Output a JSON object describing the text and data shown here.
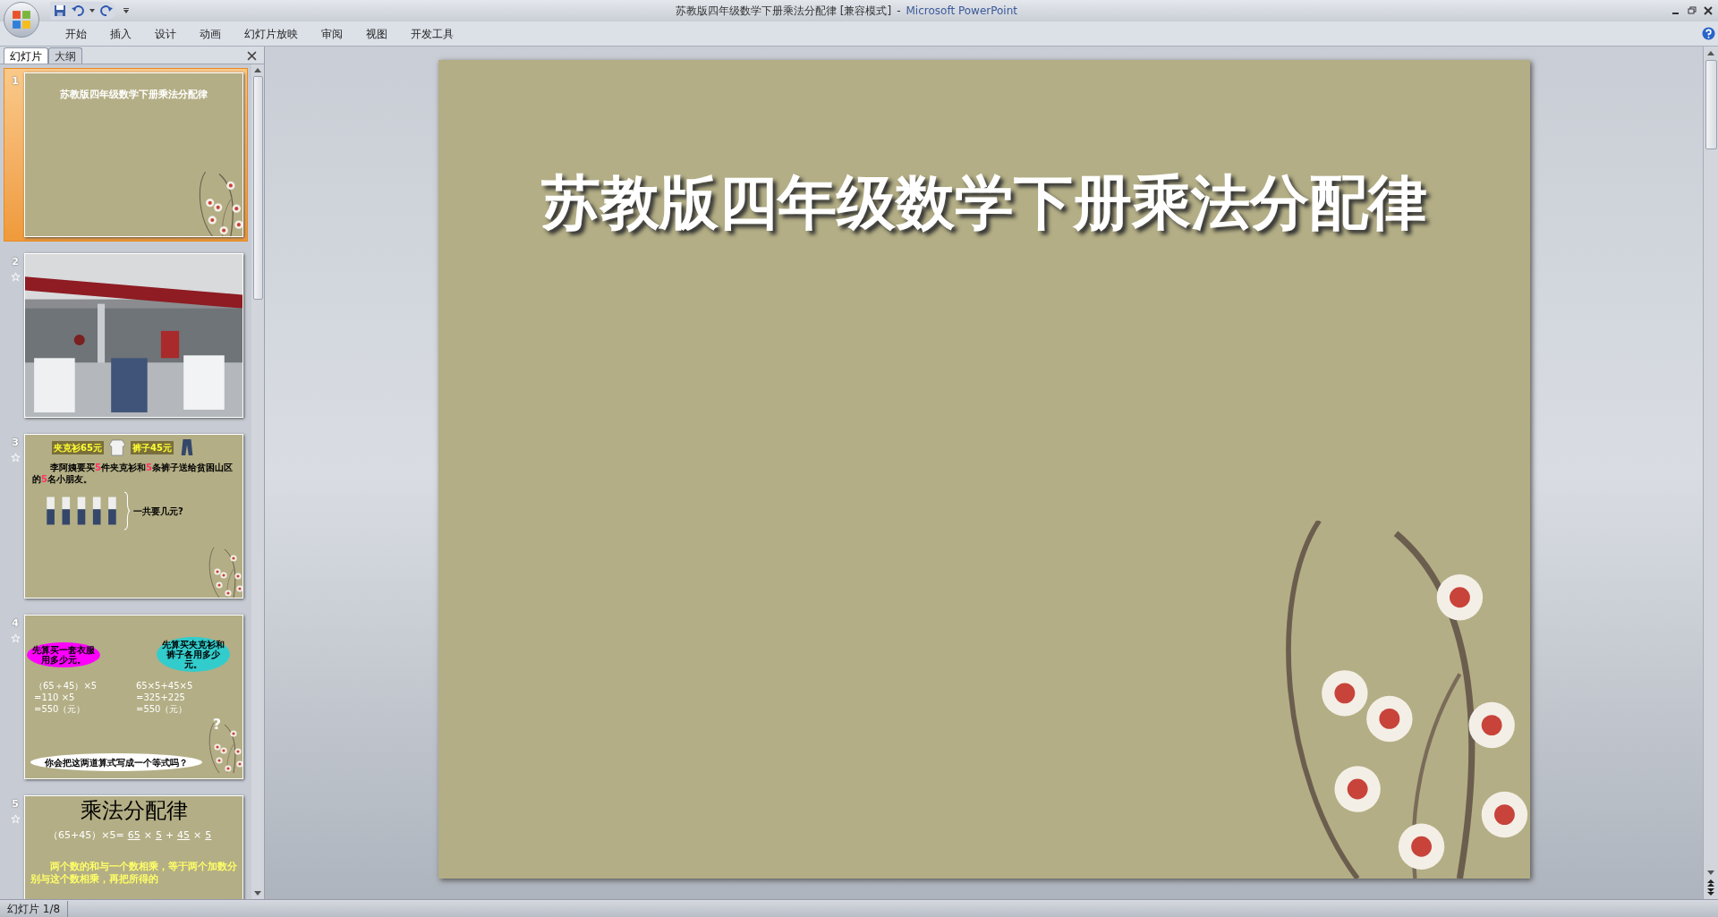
{
  "window": {
    "title": "苏教版四年级数学下册乘法分配律 [兼容模式]",
    "separator": "-",
    "app_name": "Microsoft PowerPoint"
  },
  "menu_tabs": [
    "开始",
    "插入",
    "设计",
    "动画",
    "幻灯片放映",
    "审阅",
    "视图",
    "开发工具"
  ],
  "panel_tabs": [
    {
      "label": "幻灯片",
      "selected": true
    },
    {
      "label": "大纲",
      "selected": false
    }
  ],
  "slides": [
    {
      "number": "1",
      "selected": true,
      "animated": false,
      "kind": "title",
      "title": "苏教版四年级数学下册乘法分配律"
    },
    {
      "number": "2",
      "selected": false,
      "animated": true,
      "kind": "picture"
    },
    {
      "number": "3",
      "selected": false,
      "animated": true,
      "kind": "story",
      "tags": [
        "夹克衫65元",
        "裤子45元"
      ],
      "text": "李阿姨要买**5**件夹克衫和**5**条裤子送给贫困山区的**5**名小朋友。",
      "question": "一共要几元?"
    },
    {
      "number": "4",
      "selected": false,
      "animated": true,
      "kind": "bubbles",
      "bubbles": [
        {
          "text": "先算买一套衣服用多少元。",
          "color": "#ff00ff"
        },
        {
          "text": "先算买夹克衫和裤子各用多少元。",
          "color": "#33cccc"
        }
      ],
      "left_lines": [
        "（65＋45）×5",
        "=110 ×5",
        "=550（元）"
      ],
      "right_lines": [
        "65×5+45×5",
        "=325+225",
        "=550（元）"
      ],
      "mark": "?",
      "prompt": "你会把这两道算式写成一个等式吗？"
    },
    {
      "number": "5",
      "selected": false,
      "animated": true,
      "kind": "rule",
      "title": "乘法分配律",
      "formula_start": "（65+45）×5=",
      "formula_terms": [
        "65",
        "×",
        "5",
        "+",
        "45",
        "×",
        "5"
      ],
      "text": "两个数的和与一个数相乘，等于两个加数分别与这个数相乘，再把所得的"
    }
  ],
  "slide": {
    "title": "苏教版四年级数学下册乘法分配律"
  },
  "status_bar": {
    "text": "幻灯片 1/8"
  }
}
